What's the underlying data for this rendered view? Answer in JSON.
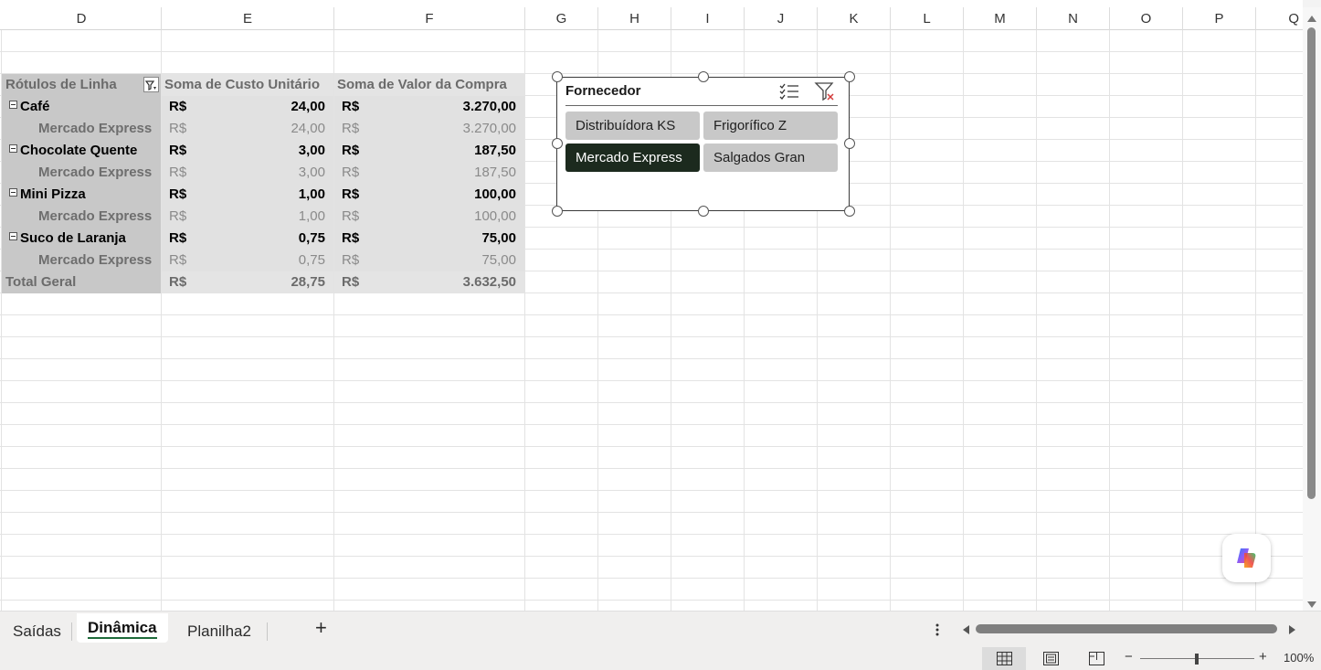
{
  "columns": [
    "D",
    "E",
    "F",
    "G",
    "H",
    "I",
    "J",
    "K",
    "L",
    "M",
    "N",
    "O",
    "P",
    "Q"
  ],
  "pivot": {
    "headers": [
      "Rótulos de Linha",
      "Soma de Custo Unitário",
      "Soma de Valor da Compra"
    ],
    "currency": "R$",
    "rows": [
      {
        "label": "Café",
        "type": "group",
        "cost": "24,00",
        "value": "3.270,00"
      },
      {
        "label": "Mercado Express",
        "type": "item",
        "cost": "24,00",
        "value": "3.270,00"
      },
      {
        "label": "Chocolate Quente",
        "type": "group",
        "cost": "3,00",
        "value": "187,50"
      },
      {
        "label": "Mercado Express",
        "type": "item",
        "cost": "3,00",
        "value": "187,50"
      },
      {
        "label": "Mini Pizza",
        "type": "group",
        "cost": "1,00",
        "value": "100,00"
      },
      {
        "label": "Mercado Express",
        "type": "item",
        "cost": "1,00",
        "value": "100,00"
      },
      {
        "label": "Suco de Laranja",
        "type": "group",
        "cost": "0,75",
        "value": "75,00"
      },
      {
        "label": "Mercado Express",
        "type": "item",
        "cost": "0,75",
        "value": "75,00"
      }
    ],
    "total": {
      "label": "Total Geral",
      "cost": "28,75",
      "value": "3.632,50"
    }
  },
  "slicer": {
    "title": "Fornecedor",
    "items": [
      {
        "label": "Distribuídora KS",
        "selected": false
      },
      {
        "label": "Frigorífico Z",
        "selected": false
      },
      {
        "label": "Mercado Express",
        "selected": true
      },
      {
        "label": "Salgados Gran",
        "selected": false
      }
    ]
  },
  "sheets": {
    "tabs": [
      "Saídas",
      "Dinâmica",
      "Planilha2"
    ],
    "active": "Dinâmica",
    "add_label": "+"
  },
  "status": {
    "zoom": "100%",
    "zoom_out": "−",
    "zoom_in": "+"
  },
  "colors": {
    "pivot_header_bg": "#e4e4e4",
    "row_label_bg": "#c8c8c8",
    "value_bg": "#e1e1e1",
    "slicer_selected": "#1c2a1e",
    "slicer_unselected": "#c8c8c8"
  }
}
